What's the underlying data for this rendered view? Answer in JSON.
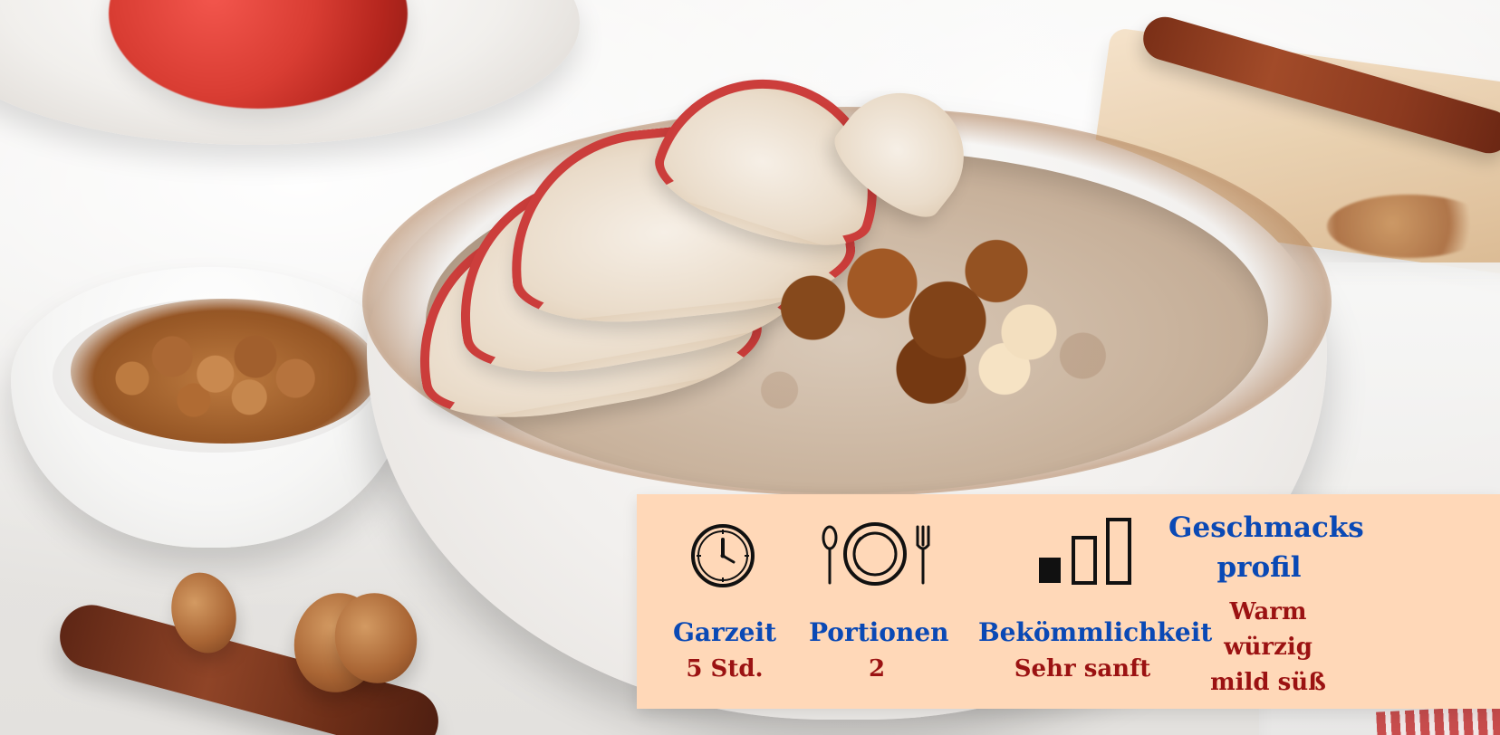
{
  "info_panel": {
    "garzeit": {
      "label": "Garzeit",
      "value": "5 Std.",
      "icon": "clock-icon"
    },
    "portionen": {
      "label": "Portionen",
      "value": "2",
      "icon": "plate-cutlery-icon"
    },
    "bekoemmlichkeit": {
      "label": "Bekömmlichkeit",
      "value": "Sehr sanft",
      "icon": "digestibility-bars-icon"
    },
    "geschmacksprofil": {
      "title_line_1": "Geschmacks",
      "title_line_2": "profil",
      "lines": [
        "Warm",
        "würzig",
        "mild süß"
      ]
    },
    "colors": {
      "panel_bg": "#ffd8b8",
      "label_blue": "#0a49b5",
      "value_red": "#9b1212",
      "icon_black": "#111111"
    }
  }
}
